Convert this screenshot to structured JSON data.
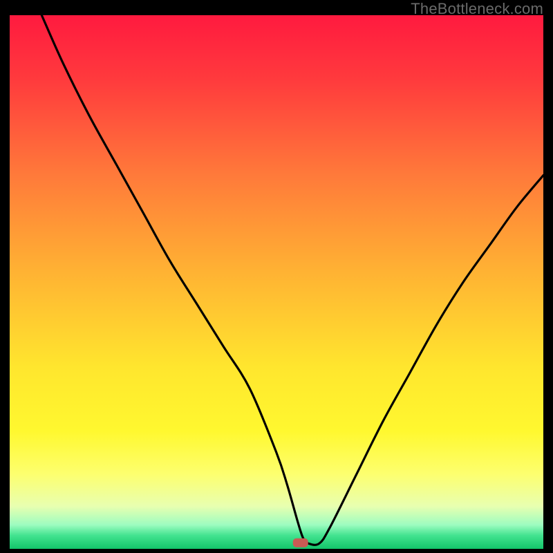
{
  "watermark": "TheBottleneck.com",
  "chart_data": {
    "type": "line",
    "title": "",
    "xlabel": "",
    "ylabel": "",
    "xlim": [
      0,
      100
    ],
    "ylim": [
      0,
      100
    ],
    "grid": false,
    "legend": false,
    "annotations": [],
    "series": [
      {
        "name": "curve",
        "x": [
          6,
          10,
          15,
          20,
          25,
          30,
          35,
          40,
          45,
          50,
          52,
          54,
          55,
          56,
          58,
          60,
          65,
          70,
          75,
          80,
          85,
          90,
          95,
          100
        ],
        "y": [
          100,
          91,
          81,
          72,
          63,
          54,
          46,
          38,
          30,
          18,
          12,
          5,
          2,
          1,
          1,
          4,
          14,
          24,
          33,
          42,
          50,
          57,
          64,
          70
        ]
      }
    ],
    "marker": {
      "x": 54.5,
      "y": 1.2
    },
    "gradient_stops": [
      {
        "offset": 0.0,
        "color": "#ff1a3f"
      },
      {
        "offset": 0.12,
        "color": "#ff3a3d"
      },
      {
        "offset": 0.3,
        "color": "#ff7a3a"
      },
      {
        "offset": 0.48,
        "color": "#ffb233"
      },
      {
        "offset": 0.66,
        "color": "#ffe62e"
      },
      {
        "offset": 0.78,
        "color": "#fff82f"
      },
      {
        "offset": 0.86,
        "color": "#fdff6f"
      },
      {
        "offset": 0.92,
        "color": "#e8ffb0"
      },
      {
        "offset": 0.955,
        "color": "#9dfcc0"
      },
      {
        "offset": 0.975,
        "color": "#42e38f"
      },
      {
        "offset": 1.0,
        "color": "#13c56a"
      }
    ]
  }
}
